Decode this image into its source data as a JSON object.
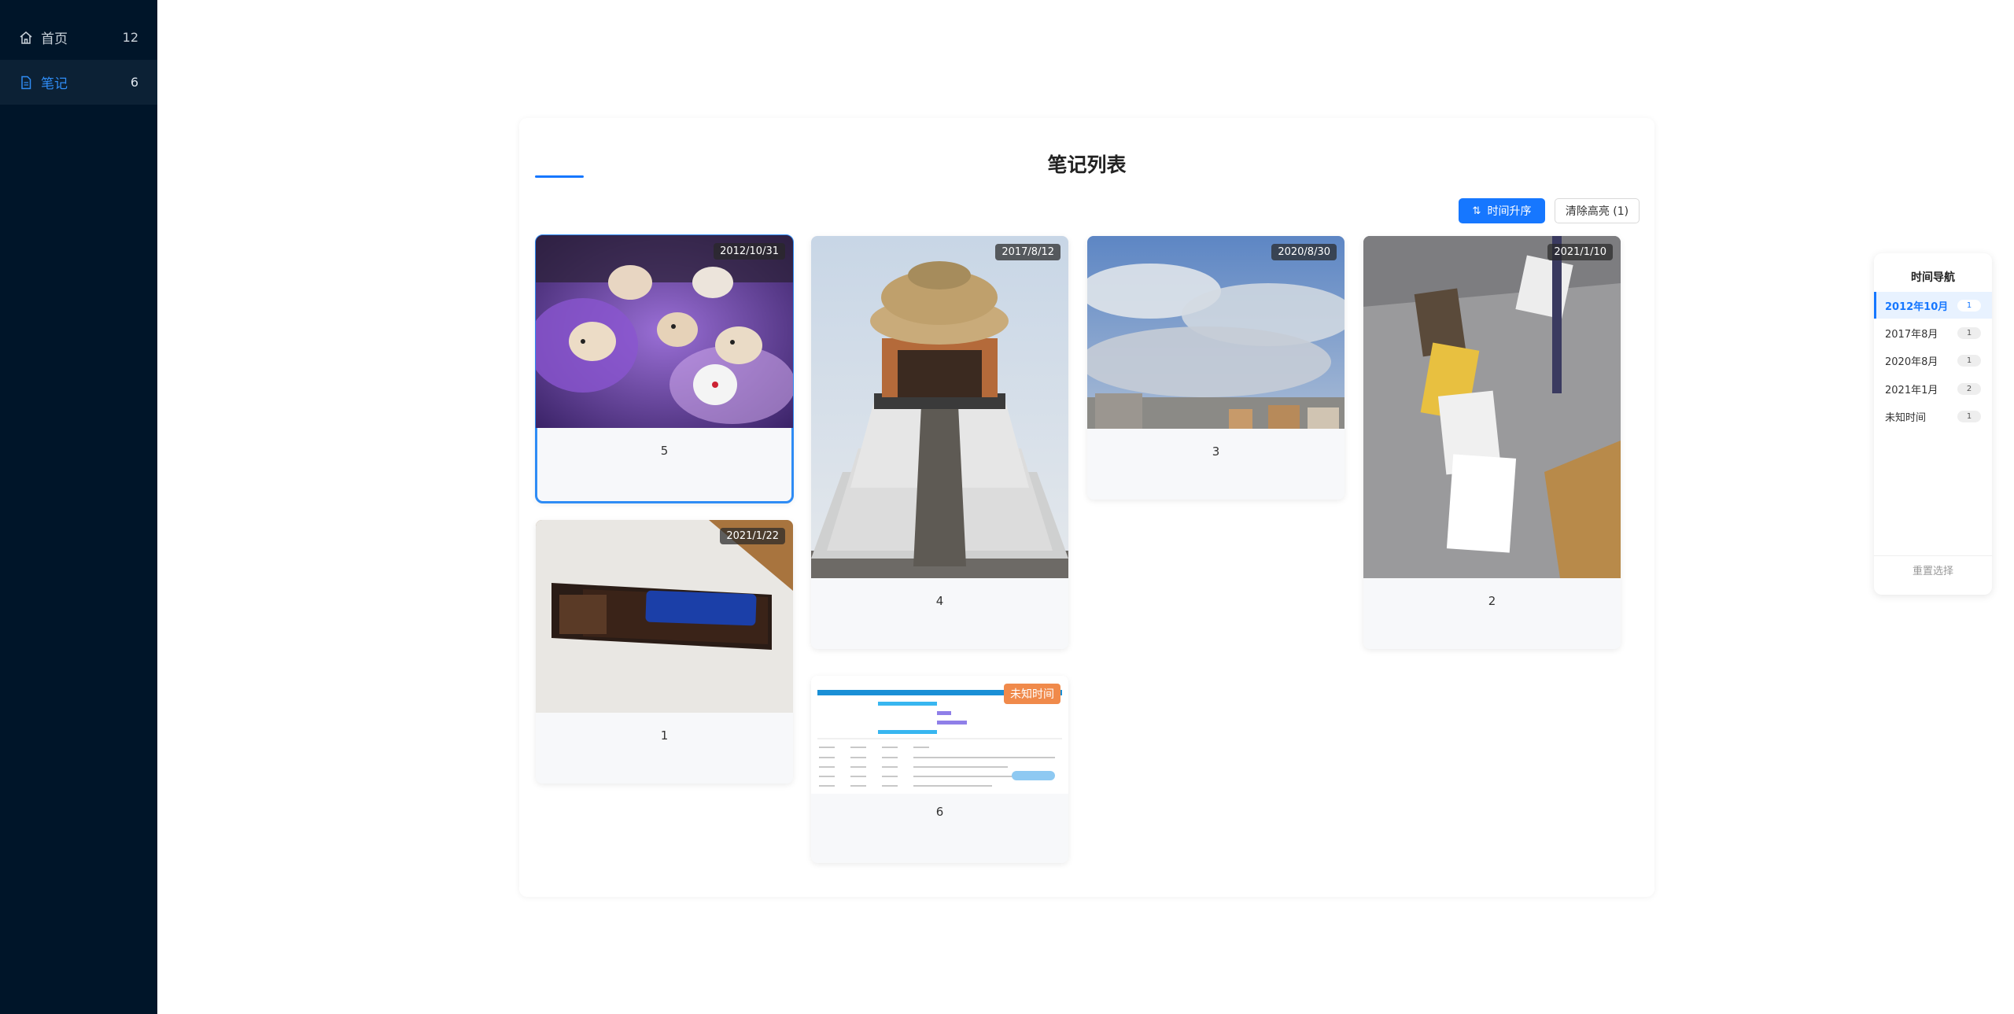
{
  "sidebar": {
    "items": [
      {
        "label": "首页",
        "count": "12",
        "icon": "home-icon"
      },
      {
        "label": "笔记",
        "count": "6",
        "icon": "document-icon"
      }
    ]
  },
  "main": {
    "title": "笔记列表",
    "sort_button": "时间升序",
    "clear_button": "清除高亮 (1)",
    "cards": [
      {
        "label": "5",
        "date": "2012/10/31",
        "selected": true
      },
      {
        "label": "4",
        "date": "2017/8/12"
      },
      {
        "label": "3",
        "date": "2020/8/30"
      },
      {
        "label": "2",
        "date": "2021/1/10"
      },
      {
        "label": "1",
        "date": "2021/1/22"
      },
      {
        "label": "6",
        "date": "未知时间"
      }
    ]
  },
  "timeline_nav": {
    "title": "时间导航",
    "items": [
      {
        "label": "2012年10月",
        "count": "1",
        "active": true
      },
      {
        "label": "2017年8月",
        "count": "1"
      },
      {
        "label": "2020年8月",
        "count": "1"
      },
      {
        "label": "2021年1月",
        "count": "2"
      },
      {
        "label": "未知时间",
        "count": "1"
      }
    ],
    "reset": "重置选择"
  },
  "colors": {
    "sidebar_bg": "#001529",
    "accent": "#1677ff",
    "unknown_badge": "#f08a4b"
  }
}
